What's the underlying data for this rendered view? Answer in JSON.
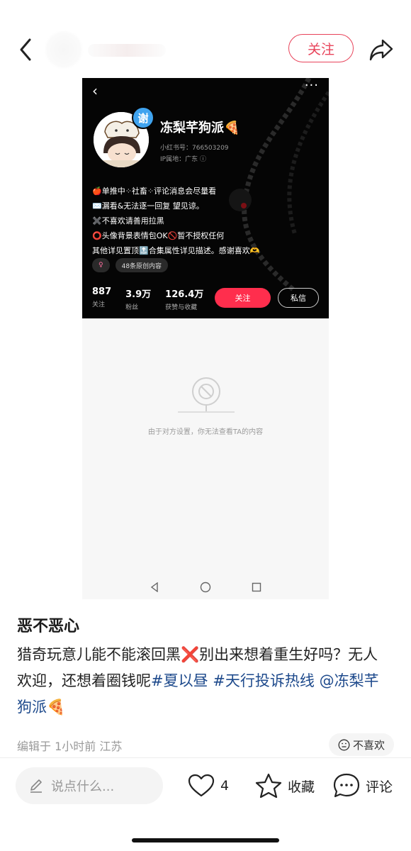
{
  "top": {
    "follow_label": "关注"
  },
  "profile": {
    "name": "冻梨芊狗派🍕",
    "badge_text": "谢",
    "id_line": "小红书号：766503209",
    "ip_line": "IP属地：广东 ⓘ",
    "bio": [
      "🍎单推中⁘社畜⁘评论消息会尽量看",
      "✉️漏看&无法逐一回复 望见谅。",
      "✖️不喜欢请善用拉黑",
      "⭕头像背景表情包OK🚫暂不授权任何",
      "其他详见置顶🔝合集属性详见描述。感谢喜欢🫶"
    ],
    "gender_tag": "♀",
    "works_tag": "48条原创内容",
    "stats": [
      {
        "num": "887",
        "label": "关注"
      },
      {
        "num": "3.9万",
        "label": "粉丝"
      },
      {
        "num": "126.4万",
        "label": "获赞与收藏"
      }
    ],
    "follow_label": "关注",
    "dm_label": "私信",
    "blocked_text": "由于对方设置，你无法查看TA的内容"
  },
  "post": {
    "title": "恶不恶心",
    "body_part1": "猎奇玩意儿能不能滚回黑❌别出来想着重生好吗？无人欢迎，还想着圈钱呢",
    "hashtag1": "#夏以昼",
    "hashtag2": "#天行投诉热线",
    "mention": "@冻梨芊狗派🍕",
    "meta": "编辑于 1小时前 江苏",
    "dislike_label": "不喜欢"
  },
  "bottom": {
    "comment_placeholder": "说点什么...",
    "like_count": "4",
    "collect_label": "收藏",
    "comment_label": "评论"
  }
}
